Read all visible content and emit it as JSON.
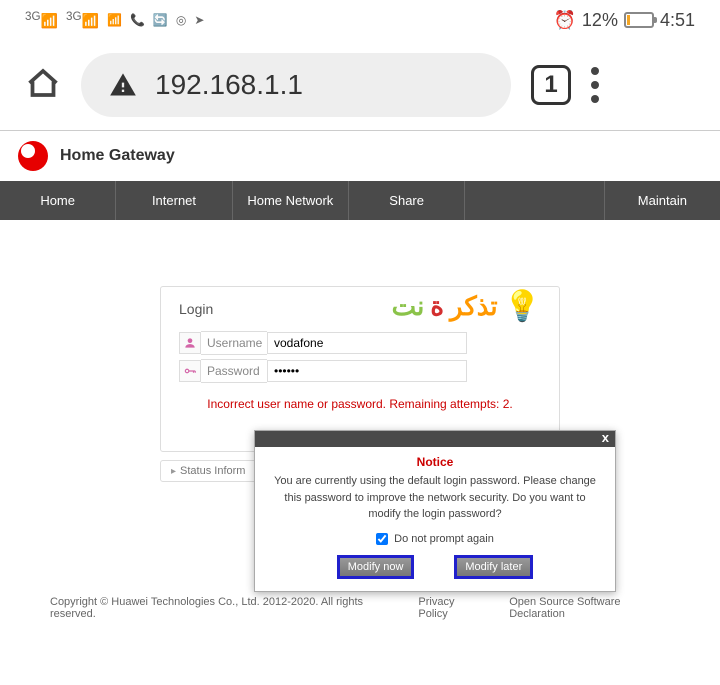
{
  "status": {
    "signal1": "3G",
    "signal2": "3G",
    "battery_pct": "12%",
    "time": "4:51"
  },
  "browser": {
    "url": "192.168.1.1",
    "tab_count": "1"
  },
  "header": {
    "title": "Home Gateway"
  },
  "nav": {
    "items": [
      "Home",
      "Internet",
      "Home Network",
      "Share",
      "",
      "Maintain"
    ]
  },
  "login": {
    "title": "Login",
    "username_label": "Username",
    "username_value": "vodafone",
    "password_label": "Password",
    "password_value": "••••••",
    "error": "Incorrect user name or password. Remaining attempts: 2."
  },
  "brand": {
    "t1": "نت",
    "t2": "ة",
    "t3": "تذكر"
  },
  "modal": {
    "title": "Notice",
    "text": "You are currently using the default login password. Please change this password to improve the network security. Do you want to modify the login password?",
    "check_label": "Do not prompt again",
    "btn_now": "Modify now",
    "btn_later": "Modify later",
    "close": "x"
  },
  "status_info": "Status Inform",
  "footer": {
    "copyright": "Copyright © Huawei Technologies Co., Ltd. 2012-2020. All rights reserved.",
    "privacy": "Privacy Policy",
    "oss": "Open Source Software Declaration"
  }
}
